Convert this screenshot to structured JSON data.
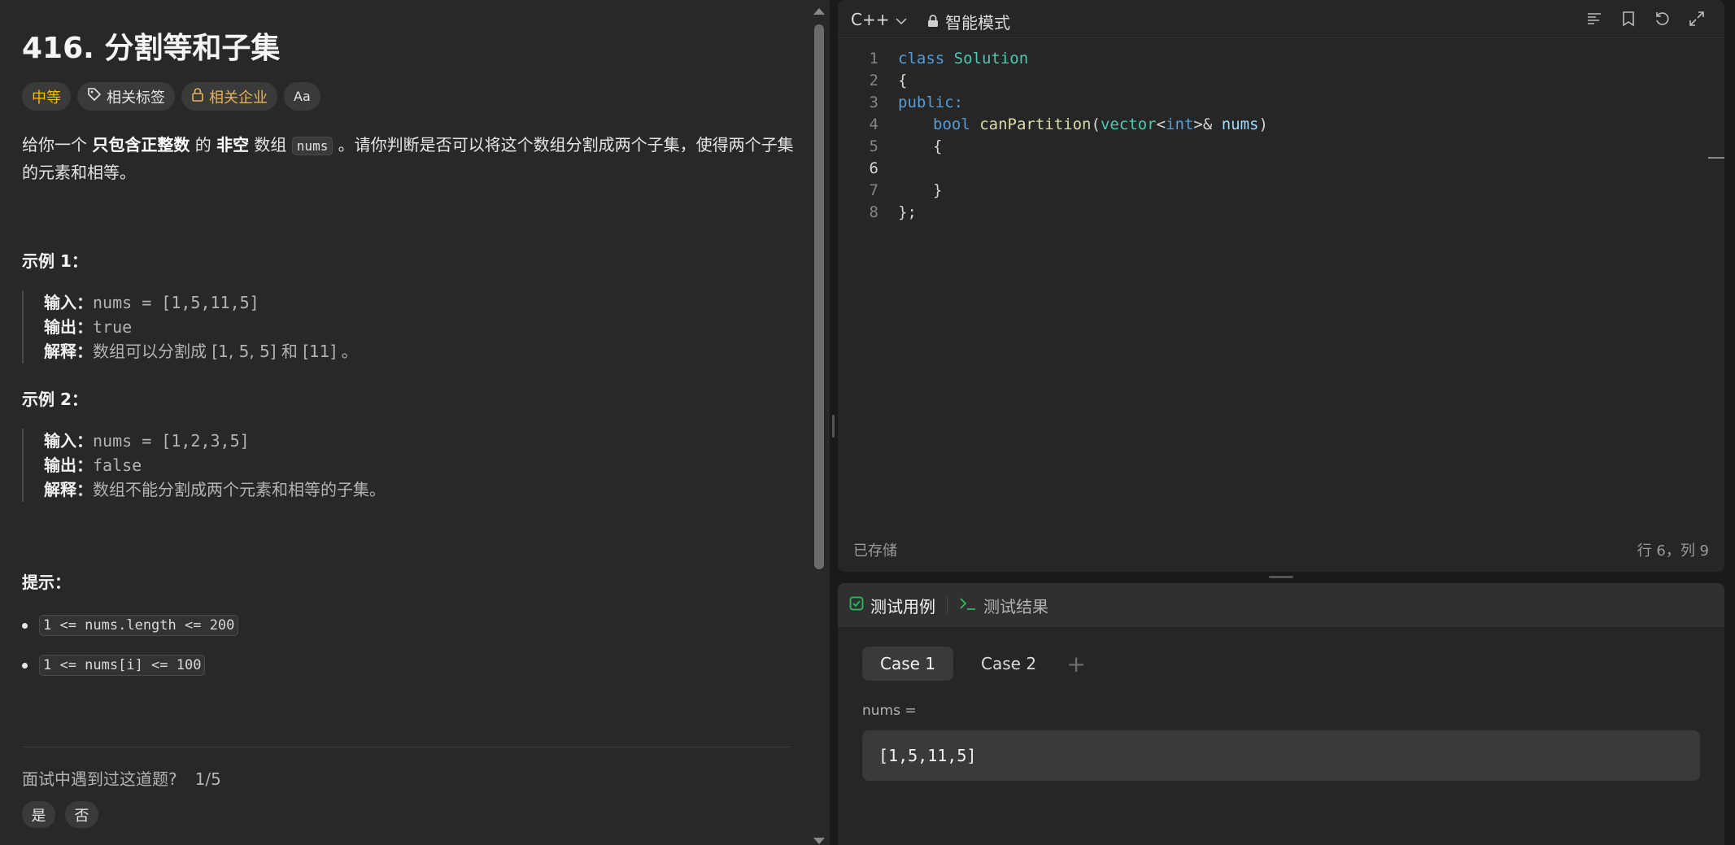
{
  "problem": {
    "title": "416. 分割等和子集",
    "tags": {
      "difficulty": "中等",
      "related_tags": "相关标签",
      "related_companies": "相关企业",
      "translate_icon": "Aa"
    },
    "description": {
      "p1": "给你一个 ",
      "b1": "只包含正整数",
      "p2": " 的 ",
      "b2": "非空",
      "p3": " 数组 ",
      "code": "nums",
      "p4": " 。请你判断是否可以将这个数组分割成两个子集，使得两个子集的元素和相等。"
    },
    "examples": [
      {
        "title": "示例 1：",
        "input_label": "输入：",
        "input": "nums = [1,5,11,5]",
        "output_label": "输出：",
        "output": "true",
        "explain_label": "解释：",
        "explain": "数组可以分割成 [1, 5, 5] 和 [11] 。"
      },
      {
        "title": "示例 2：",
        "input_label": "输入：",
        "input": "nums = [1,2,3,5]",
        "output_label": "输出：",
        "output": "false",
        "explain_label": "解释：",
        "explain": "数组不能分割成两个元素和相等的子集。"
      }
    ],
    "hints_title": "提示：",
    "hints": [
      "1 <= nums.length <= 200",
      "1 <= nums[i] <= 100"
    ],
    "interview_question": "面试中遇到过这道题?",
    "interview_count": "1/5",
    "yes": "是",
    "no": "否"
  },
  "editor": {
    "language": "C++",
    "mode": "智能模式",
    "line_numbers": [
      "1",
      "2",
      "3",
      "4",
      "5",
      "6",
      "7",
      "8"
    ],
    "active_line": 6,
    "code_tokens": {
      "l1_kw": "class",
      "l1_name": "Solution",
      "l2": "{",
      "l3": "public:",
      "l4_type": "bool",
      "l4_fn": "canPartition",
      "l4_open": "(",
      "l4_vec": "vector",
      "l4_lt": "<",
      "l4_int": "int",
      "l4_gt": ">& ",
      "l4_var": "nums",
      "l4_close": ")",
      "l5": "{",
      "l7": "}",
      "l8": "};"
    },
    "status_saved": "已存储",
    "cursor_position": "行 6，列 9"
  },
  "tests": {
    "tab_cases": "测试用例",
    "tab_results": "测试结果",
    "cases": [
      "Case 1",
      "Case 2"
    ],
    "add_case": "+",
    "param_label": "nums =",
    "param_value": "[1,5,11,5]"
  },
  "colors": {
    "difficulty_medium": "#ffb800",
    "check_green": "#2cbb5d",
    "keyword_blue": "#569cd6",
    "type_teal": "#4ec9b0",
    "function_yellow": "#dcdcaa"
  }
}
